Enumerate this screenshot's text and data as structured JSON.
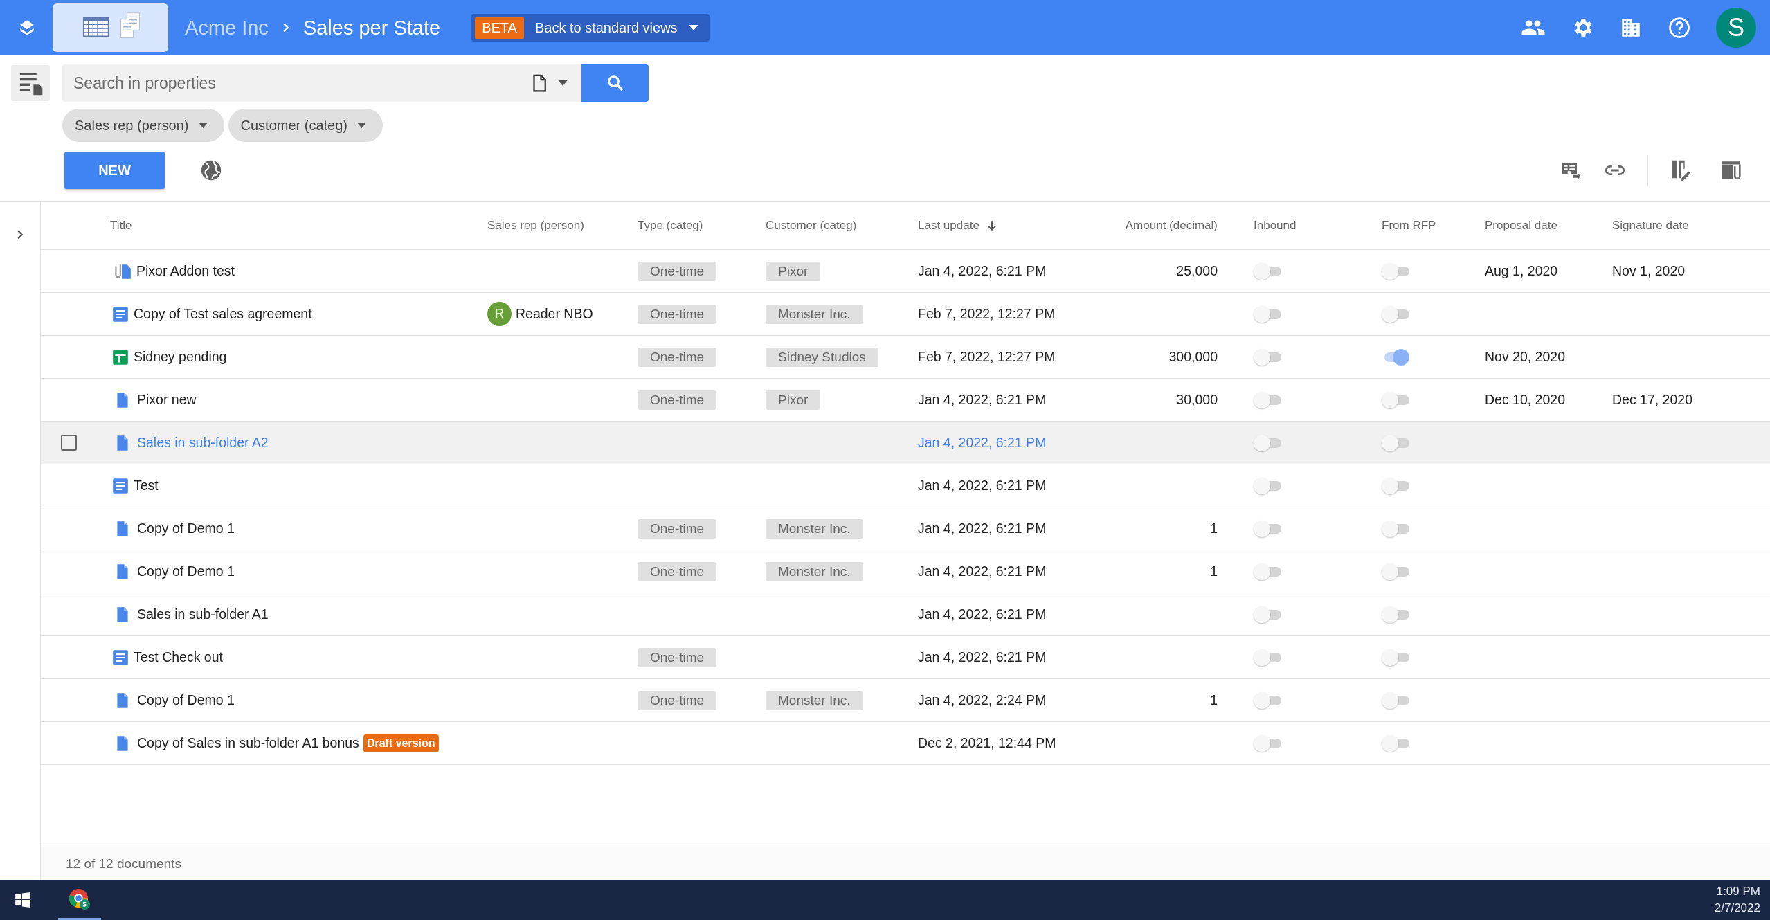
{
  "header": {
    "breadcrumb": [
      "Acme Inc",
      "Sales per State"
    ],
    "beta_badge": "BETA",
    "view_switch": "Back to standard views",
    "avatar": "S"
  },
  "search": {
    "placeholder": "Search in properties"
  },
  "filters": [
    "Sales rep (person)",
    "Customer (categ)"
  ],
  "new_button": "NEW",
  "table": {
    "columns": [
      {
        "label": "Title",
        "sorted": false
      },
      {
        "label": "Sales rep (person)",
        "sorted": false
      },
      {
        "label": "Type (categ)",
        "sorted": false
      },
      {
        "label": "Customer (categ)",
        "sorted": false
      },
      {
        "label": "Last update",
        "sorted": true
      },
      {
        "label": "Amount (decimal)",
        "sorted": false
      },
      {
        "label": "Inbound",
        "sorted": false
      },
      {
        "label": "From RFP",
        "sorted": false
      },
      {
        "label": "Proposal date",
        "sorted": false
      },
      {
        "label": "Signature date",
        "sorted": false
      }
    ],
    "rows": [
      {
        "kind": "attachment",
        "title": "Pixor Addon test",
        "highlighted": false,
        "type": "One-time",
        "customer": "Pixor",
        "last_update": "Jan 4, 2022, 6:21 PM",
        "amount": "25,000",
        "inbound": false,
        "from_rfp": false,
        "proposal_date": "Aug 1, 2020",
        "signature_date": "Nov 1, 2020"
      },
      {
        "kind": "doc",
        "title": "Copy of Test sales agreement",
        "highlighted": false,
        "sales_rep": {
          "initial": "R",
          "name": "Reader NBO"
        },
        "type": "One-time",
        "customer": "Monster Inc.",
        "last_update": "Feb 7, 2022, 12:27 PM",
        "inbound": false,
        "from_rfp": false
      },
      {
        "kind": "sheet",
        "title": "Sidney pending",
        "highlighted": false,
        "type": "One-time",
        "customer": "Sidney Studios",
        "last_update": "Feb 7, 2022, 12:27 PM",
        "amount": "300,000",
        "inbound": false,
        "from_rfp": true,
        "proposal_date": "Nov 20, 2020"
      },
      {
        "kind": "file",
        "title": "Pixor new",
        "highlighted": false,
        "type": "One-time",
        "customer": "Pixor",
        "last_update": "Jan 4, 2022, 6:21 PM",
        "amount": "30,000",
        "inbound": false,
        "from_rfp": false,
        "proposal_date": "Dec 10, 2020",
        "signature_date": "Dec 17, 2020"
      },
      {
        "kind": "file",
        "title": "Sales in sub-folder A2",
        "highlighted": true,
        "last_update": "Jan 4, 2022, 6:21 PM",
        "inbound": false,
        "from_rfp": false
      },
      {
        "kind": "doc",
        "title": "Test",
        "highlighted": false,
        "last_update": "Jan 4, 2022, 6:21 PM",
        "inbound": false,
        "from_rfp": false
      },
      {
        "kind": "file",
        "title": "Copy of Demo 1",
        "highlighted": false,
        "type": "One-time",
        "customer": "Monster Inc.",
        "last_update": "Jan 4, 2022, 6:21 PM",
        "amount": "1",
        "inbound": false,
        "from_rfp": false
      },
      {
        "kind": "file",
        "title": "Copy of Demo 1",
        "highlighted": false,
        "type": "One-time",
        "customer": "Monster Inc.",
        "last_update": "Jan 4, 2022, 6:21 PM",
        "amount": "1",
        "inbound": false,
        "from_rfp": false
      },
      {
        "kind": "file",
        "title": "Sales in sub-folder A1",
        "highlighted": false,
        "last_update": "Jan 4, 2022, 6:21 PM",
        "inbound": false,
        "from_rfp": false
      },
      {
        "kind": "doc",
        "title": "Test Check out",
        "highlighted": false,
        "type": "One-time",
        "last_update": "Jan 4, 2022, 6:21 PM",
        "inbound": false,
        "from_rfp": false
      },
      {
        "kind": "file",
        "title": "Copy of Demo 1",
        "highlighted": false,
        "type": "One-time",
        "customer": "Monster Inc.",
        "last_update": "Jan 4, 2022, 2:24 PM",
        "amount": "1",
        "inbound": false,
        "from_rfp": false
      },
      {
        "kind": "file",
        "title": "Copy of Sales in sub-folder A1 bonus",
        "badge": "Draft version",
        "highlighted": false,
        "last_update": "Dec 2, 2021, 12:44 PM",
        "inbound": false,
        "from_rfp": false
      }
    ]
  },
  "footer": "12 of 12 documents",
  "taskbar": {
    "time": "1:09 PM",
    "date": "2/7/2022"
  }
}
